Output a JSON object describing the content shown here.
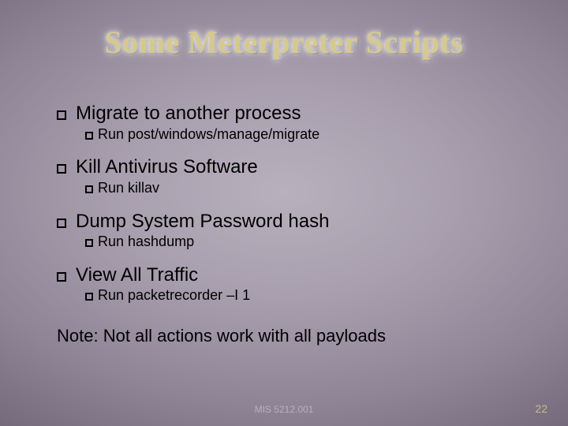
{
  "title": "Some Meterpreter Scripts",
  "items": [
    {
      "heading": "Migrate to another process",
      "sub": "Run post/windows/manage/migrate"
    },
    {
      "heading": "Kill Antivirus Software",
      "sub": "Run killav"
    },
    {
      "heading": "Dump System Password hash",
      "sub": "Run hashdump"
    },
    {
      "heading": "View All Traffic",
      "sub": "Run packetrecorder –I 1"
    }
  ],
  "note": "Note: Not all actions work with all payloads",
  "footer": {
    "course": "MIS 5212.001",
    "page": "22"
  }
}
